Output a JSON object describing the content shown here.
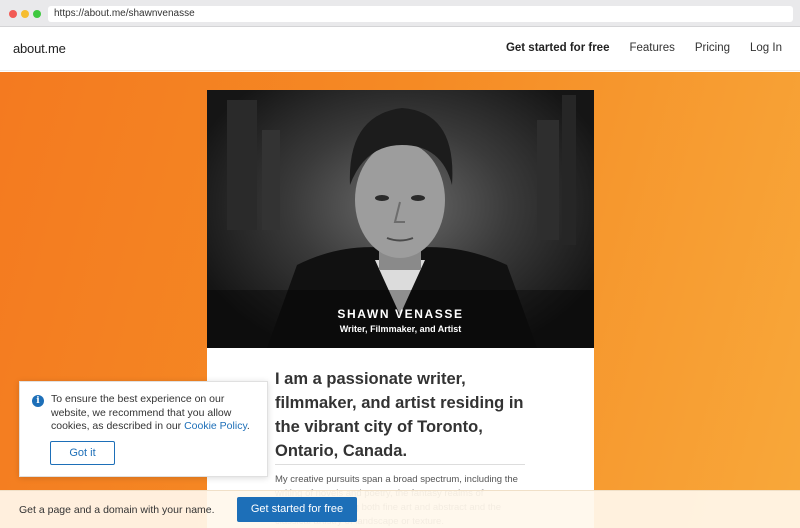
{
  "browser": {
    "url": "https://about.me/shawnvenasse"
  },
  "header": {
    "logo": "about.me",
    "nav": [
      {
        "label": "Get started for free"
      },
      {
        "label": "Features"
      },
      {
        "label": "Pricing"
      },
      {
        "label": "Log In"
      }
    ]
  },
  "profile": {
    "name": "SHAWN VENASSE",
    "tagline": "Writer, Filmmaker, and Artist",
    "headline": "I am a passionate writer, filmmaker, and artist residing in the vibrant city of Toronto, Ontario, Canada.",
    "body": "My creative pursuits span a broad spectrum, including the writing of novels and poetry, the fantasy realms of filmmaking, painting both fine art and abstract and the classical artistry of landscape or texture."
  },
  "cookie": {
    "text": "To ensure the best experience on our website, we recommend that you allow cookies, as described in our ",
    "link": "Cookie Policy",
    "after_link": ".",
    "button": "Got it"
  },
  "bottom_bar": {
    "text": "Get a page and a domain with your name.",
    "button": "Get started for free"
  },
  "colors": {
    "accent": "#1d6fb8",
    "background_start": "#f47a20",
    "background_end": "#f8a83a"
  }
}
